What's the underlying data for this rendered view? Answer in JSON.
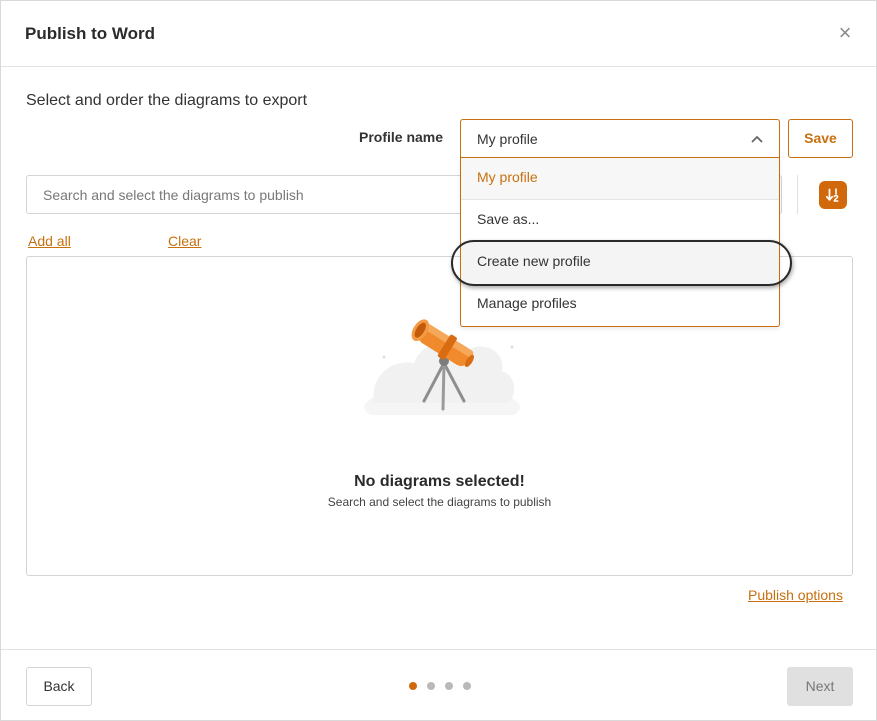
{
  "dialog": {
    "title": "Publish to Word",
    "close_symbol": "×",
    "subtitle": "Select and order the diagrams to export"
  },
  "profile": {
    "label": "Profile name",
    "selected": "My profile",
    "save_label": "Save",
    "options": [
      {
        "label": "My profile"
      },
      {
        "label": "Save as..."
      },
      {
        "label": "Create new profile"
      },
      {
        "label": "Manage profiles"
      }
    ]
  },
  "search": {
    "placeholder": "Search and select the diagrams to publish"
  },
  "links": {
    "add_all": "Add all",
    "clear": "Clear",
    "publish_options": "Publish options"
  },
  "empty_state": {
    "title": "No diagrams selected!",
    "subtitle": "Search and select the diagrams to publish"
  },
  "footer": {
    "back_label": "Back",
    "next_label": "Next",
    "step_current": 1,
    "step_total": 4
  },
  "colors": {
    "accent": "#c8700f",
    "sort_button": "#d2680c",
    "dot_active": "#d2680c",
    "dot_inactive": "#b9b9b9"
  },
  "icons": {
    "close": "close-icon",
    "chevron": "chevron-up-icon",
    "sort": "sort-icon",
    "illustration": "telescope-illustration"
  }
}
